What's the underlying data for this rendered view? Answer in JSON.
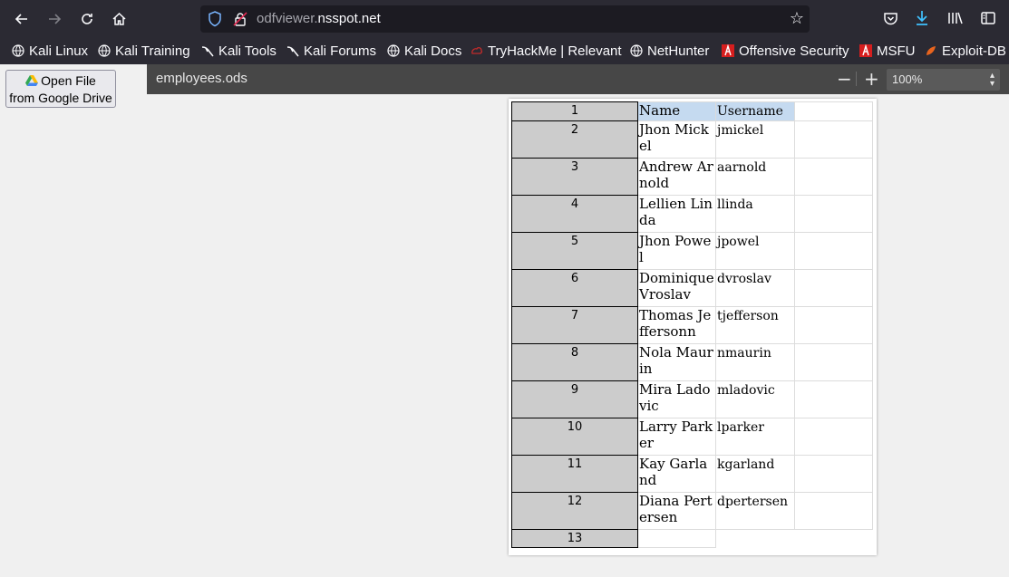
{
  "browser": {
    "url_dim": "odfviewer.",
    "url_host": "nsspot.net",
    "bookmarks": [
      {
        "label": "Kali Linux",
        "icon": "globe-icon"
      },
      {
        "label": "Kali Training",
        "icon": "globe-icon"
      },
      {
        "label": "Kali Tools",
        "icon": "kali-dragon-icon"
      },
      {
        "label": "Kali Forums",
        "icon": "kali-dragon-icon"
      },
      {
        "label": "Kali Docs",
        "icon": "globe-icon"
      },
      {
        "label": "TryHackMe | Relevant",
        "icon": "tryhackme-icon"
      },
      {
        "label": "NetHunter",
        "icon": "globe-icon"
      },
      {
        "label": "Offensive Security",
        "icon": "offsec-icon"
      },
      {
        "label": "MSFU",
        "icon": "offsec-icon"
      },
      {
        "label": "Exploit-DB",
        "icon": "exploitdb-icon"
      }
    ]
  },
  "drive_button": {
    "line1": "Open File",
    "line2": "from Google Drive"
  },
  "viewer": {
    "filename": "employees.ods",
    "zoom_minus": "−",
    "zoom_plus": "+",
    "zoom": "100%"
  },
  "sheet": {
    "headers": {
      "name": "Name",
      "username": "Username"
    },
    "row_numbers": [
      "1",
      "2",
      "3",
      "4",
      "5",
      "6",
      "7",
      "8",
      "9",
      "10",
      "11",
      "12",
      "13"
    ],
    "rows": [
      {
        "name": "Jhon Mickel",
        "username": "jmickel"
      },
      {
        "name": "Andrew Arnold",
        "username": "aarnold"
      },
      {
        "name": "Lellien Linda",
        "username": "llinda"
      },
      {
        "name": "Jhon Powel",
        "username": "jpowel"
      },
      {
        "name": "Dominique Vroslav",
        "username": "dvroslav"
      },
      {
        "name": "Thomas Jeffersonn",
        "username": "tjefferson"
      },
      {
        "name": "Nola Maurin",
        "username": "nmaurin"
      },
      {
        "name": "Mira Ladovic",
        "username": "mladovic"
      },
      {
        "name": "Larry Parker",
        "username": "lparker"
      },
      {
        "name": "Kay Garland",
        "username": "kgarland"
      },
      {
        "name": "Diana Pertersen",
        "username": "dpertersen"
      }
    ]
  },
  "colors": {
    "toolbar": "#2b2a33",
    "header_cell": "#c5daf0",
    "row_header": "#cccccc"
  }
}
